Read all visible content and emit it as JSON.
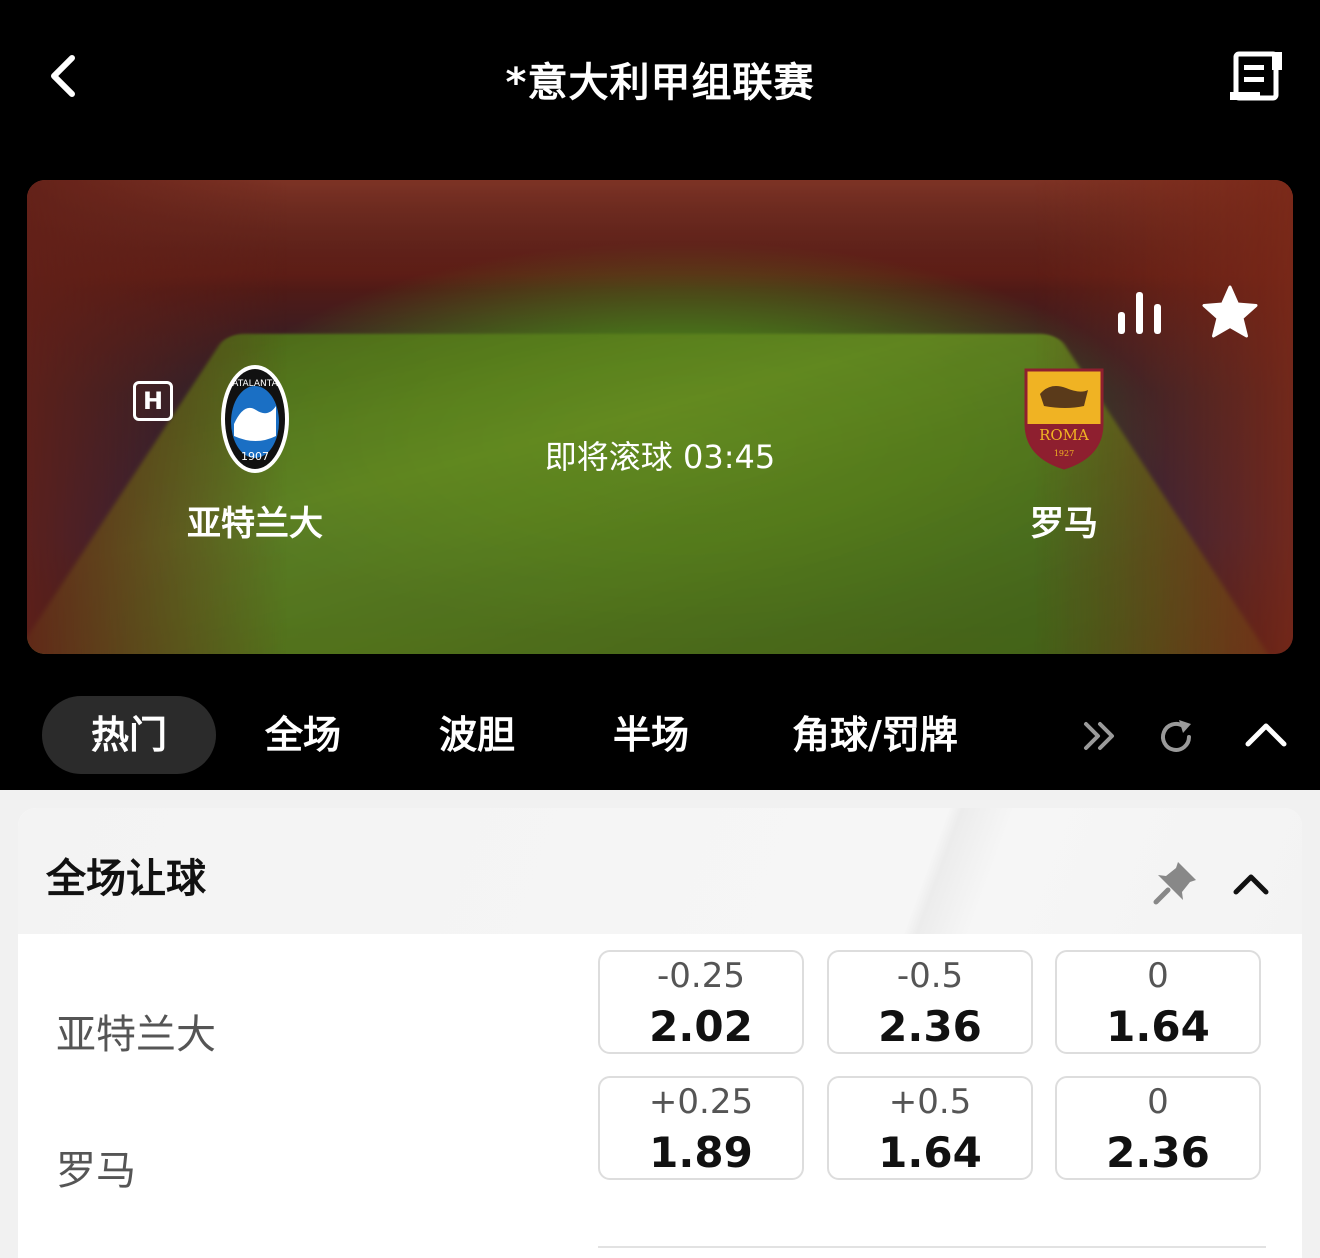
{
  "header": {
    "title": "*意大利甲组联赛",
    "back_icon": "chevron-left-icon",
    "betslip_icon": "betslip-icon"
  },
  "match": {
    "home_badge": "H",
    "home_team": "亚特兰大",
    "away_team": "罗马",
    "status": "即将滚球 03:45",
    "home_logo_text": [
      "ATALANTA",
      "1907"
    ],
    "away_logo_text": [
      "ROMA",
      "1927"
    ]
  },
  "tabs": [
    {
      "label": "热门",
      "active": true
    },
    {
      "label": "全场",
      "active": false
    },
    {
      "label": "波胆",
      "active": false
    },
    {
      "label": "半场",
      "active": false
    },
    {
      "label": "角球/罚牌",
      "active": false
    }
  ],
  "market": {
    "title": "全场让球",
    "rows": [
      {
        "team": "亚特兰大",
        "odds": [
          {
            "line": "-0.25",
            "price": "2.02"
          },
          {
            "line": "-0.5",
            "price": "2.36"
          },
          {
            "line": "0",
            "price": "1.64"
          }
        ]
      },
      {
        "team": "罗马",
        "odds": [
          {
            "line": "+0.25",
            "price": "1.89"
          },
          {
            "line": "+0.5",
            "price": "1.64"
          },
          {
            "line": "0",
            "price": "2.36"
          }
        ]
      }
    ]
  },
  "colors": {
    "background": "#000000",
    "panel": "#f1f1f1",
    "active_tab": "#2b2b2b",
    "odds_border": "#dddddd"
  }
}
